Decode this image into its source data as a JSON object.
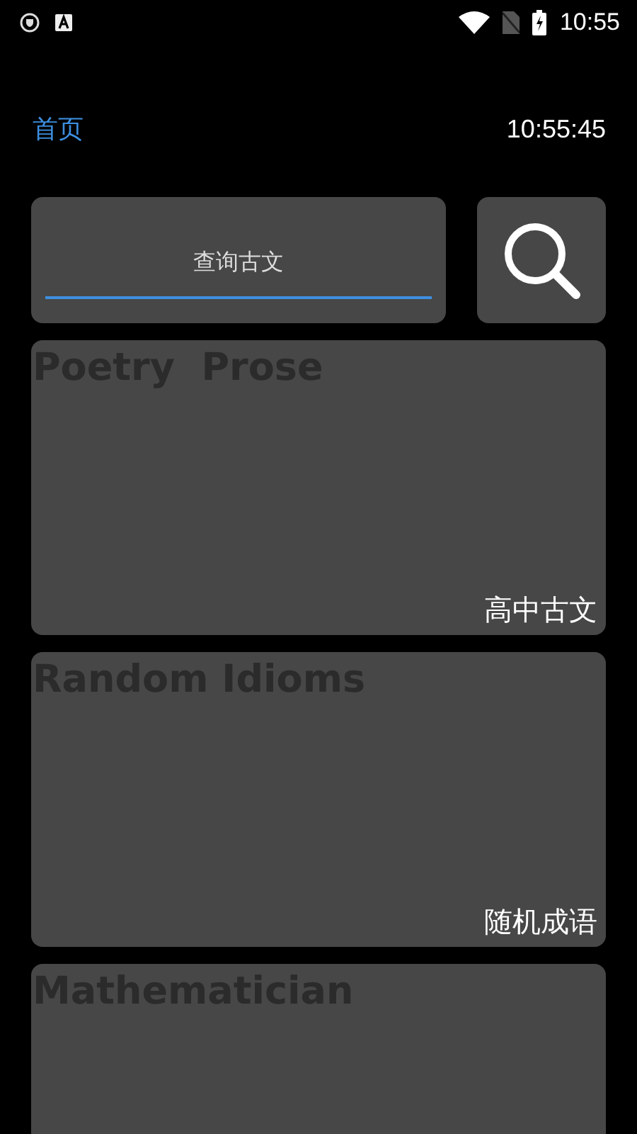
{
  "status_bar": {
    "time": "10:55"
  },
  "header": {
    "title": "首页",
    "clock": "10:55:45"
  },
  "search": {
    "placeholder": "查询古文"
  },
  "cards": [
    {
      "title": "Poetry  Prose",
      "label": "高中古文"
    },
    {
      "title": "Random Idioms",
      "label": "随机成语"
    },
    {
      "title": "Mathematician"
    }
  ]
}
